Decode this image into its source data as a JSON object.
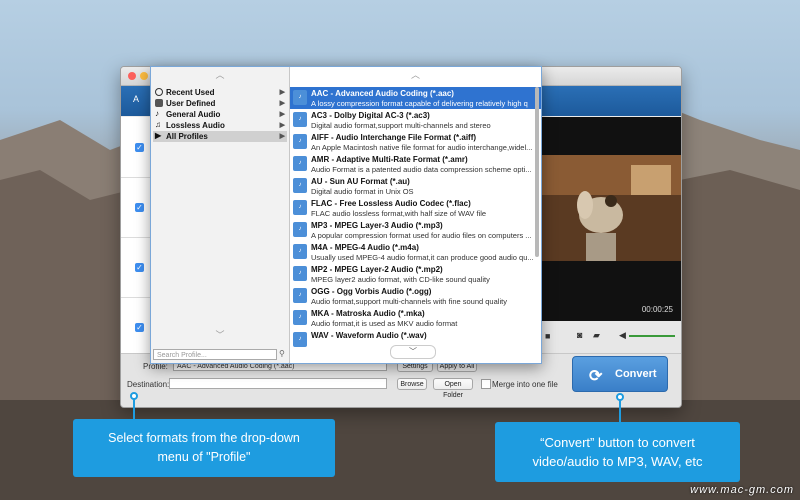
{
  "app": {
    "toolbar_label": "A"
  },
  "popup": {
    "categories": [
      {
        "label": "Recent Used",
        "icon": "clock-icon"
      },
      {
        "label": "User Defined",
        "icon": "user-icon"
      },
      {
        "label": "General Audio",
        "icon": "music-note-icon"
      },
      {
        "label": "Lossless Audio",
        "icon": "music-note-icon"
      },
      {
        "label": "All Profiles",
        "icon": "play-icon"
      }
    ],
    "search_placeholder": "Search Profile...",
    "formats": [
      {
        "title": "AAC - Advanced Audio Coding (*.aac)",
        "desc": "A lossy compression format capable of delivering relatively high q"
      },
      {
        "title": "AC3 - Dolby Digital AC-3 (*.ac3)",
        "desc": "Digital audio format,support multi-channels and stereo"
      },
      {
        "title": "AIFF - Audio Interchange File Format (*.aiff)",
        "desc": "An Apple Macintosh native file format for audio interchange,widel..."
      },
      {
        "title": "AMR - Adaptive Multi-Rate Format (*.amr)",
        "desc": "Audio Format is a patented audio data compression scheme opti..."
      },
      {
        "title": "AU - Sun AU Format (*.au)",
        "desc": "Digital audio format in Unix OS"
      },
      {
        "title": "FLAC - Free Lossless Audio Codec (*.flac)",
        "desc": "FLAC audio lossless format,with half size of WAV file"
      },
      {
        "title": "MP3 - MPEG Layer-3 Audio (*.mp3)",
        "desc": "A popular compression format used for audio files on computers ..."
      },
      {
        "title": "M4A - MPEG-4 Audio (*.m4a)",
        "desc": "Usually used MPEG-4 audio format,it can produce good audio qu..."
      },
      {
        "title": "MP2 - MPEG Layer-2 Audio (*.mp2)",
        "desc": "MPEG layer2 audio format, with CD-like sound quality"
      },
      {
        "title": "OGG - Ogg Vorbis Audio (*.ogg)",
        "desc": "Audio format,support multi-channels with fine sound quality"
      },
      {
        "title": "MKA - Matroska Audio (*.mka)",
        "desc": "Audio format,it is used as MKV audio format"
      },
      {
        "title": "WAV - Waveform Audio (*.wav)",
        "desc": ""
      }
    ]
  },
  "bottom": {
    "profile_label": "Profile:",
    "profile_value": "AAC - Advanced Audio Coding (*.aac)",
    "settings_label": "Settings",
    "apply_all_label": "Apply to All",
    "destination_label": "Destination:",
    "browse_label": "Browse",
    "open_folder_label": "Open Folder",
    "merge_label": "Merge into one file",
    "convert_label": "Convert"
  },
  "preview": {
    "time": "00:00:25"
  },
  "callouts": {
    "left_line1": "Select formats from the drop-down",
    "left_line2": "menu of \"Profile\"",
    "right_line1": "“Convert” button to convert",
    "right_line2": "video/audio to MP3, WAV, etc"
  },
  "watermark": "www.mac-gm.com",
  "colors": {
    "accent": "#1e9ce0",
    "selection": "#2f73d0",
    "convert": "#3a7fc8"
  }
}
